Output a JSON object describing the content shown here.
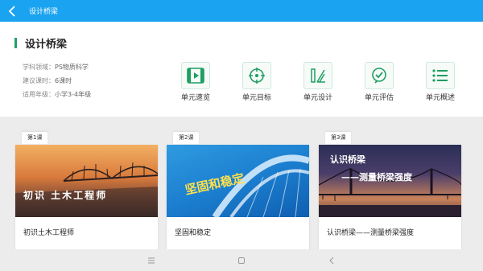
{
  "topbar": {
    "title": "设计桥梁",
    "back_icon": "chevron-left-icon"
  },
  "page": {
    "title": "设计桥梁",
    "accent_color": "#22a06b"
  },
  "meta": {
    "subject_label": "学科领域：",
    "subject_value": "PS物质科学",
    "hours_label": "建议课时：",
    "hours_value": "6课时",
    "grade_label": "适用年级：",
    "grade_value": "小学3-4年级"
  },
  "units": [
    {
      "label": "单元速览",
      "icon": "film-icon"
    },
    {
      "label": "单元目标",
      "icon": "target-icon"
    },
    {
      "label": "单元设计",
      "icon": "design-tools-icon"
    },
    {
      "label": "单元评估",
      "icon": "check-bubble-icon"
    },
    {
      "label": "单元概述",
      "icon": "list-icon"
    }
  ],
  "lessons": [
    {
      "tag": "第1课",
      "title": "初识土木工程师",
      "image_text": "初识 土木工程师"
    },
    {
      "tag": "第2课",
      "title": "坚固和稳定",
      "image_text": "坚固和稳定"
    },
    {
      "tag": "第3课",
      "title": "认识桥梁——测量桥梁强度",
      "image_text_top": "认识桥梁",
      "image_text_bottom": "——测量桥梁强度"
    }
  ],
  "colors": {
    "topbar": "#1aa3f0",
    "icon_green": "#1f9e62"
  }
}
